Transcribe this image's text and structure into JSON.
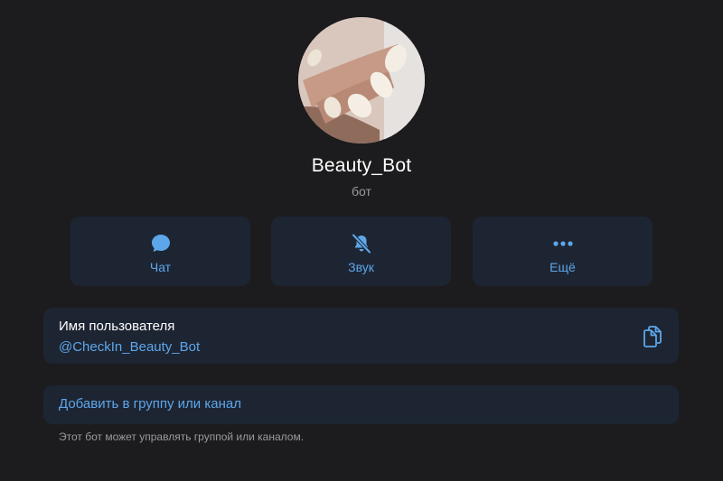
{
  "profile": {
    "name": "Beauty_Bot",
    "subtitle": "бот"
  },
  "actions": [
    {
      "label": "Чат",
      "icon": "chat-bubble-icon"
    },
    {
      "label": "Звук",
      "icon": "bell-muted-icon"
    },
    {
      "label": "Ещё",
      "icon": "more-dots-icon"
    }
  ],
  "username": {
    "title": "Имя пользователя",
    "value": "@CheckIn_Beauty_Bot",
    "copy_icon": "copy-icon"
  },
  "add_to_group": {
    "label": "Добавить в группу или канал",
    "hint": "Этот бот может управлять группой или каналом."
  },
  "colors": {
    "background": "#1c1c1e",
    "card": "#1d2533",
    "accent": "#5ea6ea",
    "secondary_text": "#9a9aa0"
  }
}
